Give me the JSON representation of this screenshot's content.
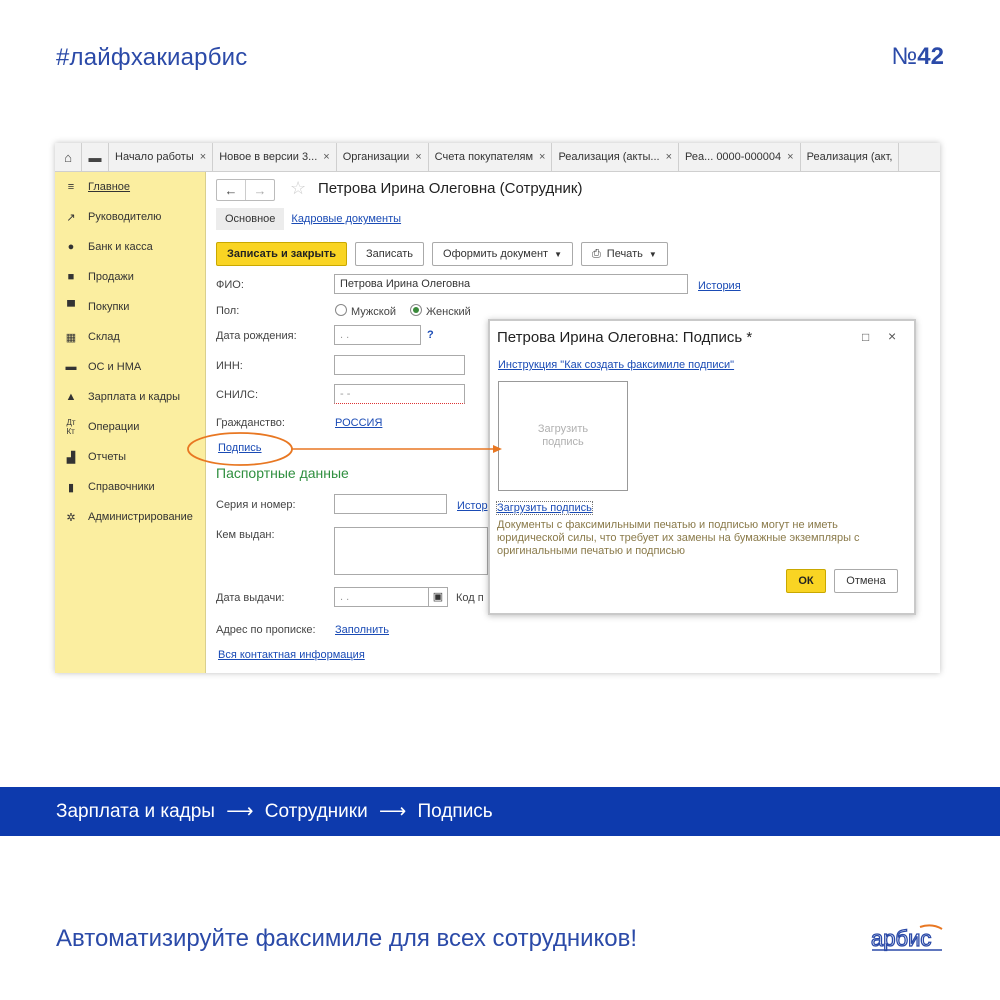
{
  "header": {
    "hashtag": "#лайфхакиарбис",
    "number_prefix": "№",
    "number": "42"
  },
  "tabs": [
    {
      "label": "Начало работы",
      "close": "×"
    },
    {
      "label": "Новое в версии 3...",
      "close": "×"
    },
    {
      "label": "Организации",
      "close": "×"
    },
    {
      "label": "Счета покупателям",
      "close": "×"
    },
    {
      "label": "Реализация (акты...",
      "close": "×"
    },
    {
      "label": "Реа...   0000-000004",
      "close": "×"
    },
    {
      "label": "Реализация (акт,",
      "close": ""
    }
  ],
  "sidebar": {
    "items": [
      {
        "label": "Главное",
        "icon": "menu-icon"
      },
      {
        "label": "Руководителю",
        "icon": "trend-icon"
      },
      {
        "label": "Банк и касса",
        "icon": "coin-icon"
      },
      {
        "label": "Продажи",
        "icon": "bag-icon"
      },
      {
        "label": "Покупки",
        "icon": "cart-icon"
      },
      {
        "label": "Склад",
        "icon": "warehouse-icon"
      },
      {
        "label": "ОС и НМА",
        "icon": "truck-icon"
      },
      {
        "label": "Зарплата и кадры",
        "icon": "person-icon"
      },
      {
        "label": "Операции",
        "icon": "operations-icon"
      },
      {
        "label": "Отчеты",
        "icon": "bar-chart-icon"
      },
      {
        "label": "Справочники",
        "icon": "book-icon"
      },
      {
        "label": "Администрирование",
        "icon": "gear-icon"
      }
    ]
  },
  "form": {
    "title": "Петрова Ирина Олеговна (Сотрудник)",
    "subtab_main": "Основное",
    "subtab_hr": "Кадровые документы",
    "btn_save_close": "Записать и закрыть",
    "btn_save": "Записать",
    "btn_make_doc": "Оформить документ",
    "btn_print": "Печать",
    "fio_label": "ФИО:",
    "fio_value": "Петрова Ирина Олеговна",
    "history": "История",
    "gender_label": "Пол:",
    "gender_male": "Мужской",
    "gender_female": "Женский",
    "birth_label": "Дата рождения:",
    "birth_value": ". .",
    "help": "?",
    "inn_label": "ИНН:",
    "snils_label": "СНИЛС:",
    "snils_value": "-   -",
    "citizenship_label": "Гражданство:",
    "citizenship_value": "РОССИЯ",
    "signature_link": "Подпись",
    "passport_header": "Паспортные данные",
    "series_label": "Серия и номер:",
    "series_history": "Истор",
    "issued_by_label": "Кем выдан:",
    "issue_date_label": "Дата выдачи:",
    "issue_date_value": ". .",
    "code_label": "Код п",
    "address_label": "Адрес по прописке:",
    "address_fill": "Заполнить",
    "all_contacts": "Вся контактная информация"
  },
  "dialog": {
    "title": "Петрова Ирина Олеговна: Подпись *",
    "maximize": "□",
    "close": "×",
    "instruction": "Инструкция \"Как создать факсимиле подписи\"",
    "placeholder": "Загрузить подпись",
    "upload_link": "Загрузить подпись",
    "note": "Документы с факсимильными печатью и подписью могут не иметь юридической силы, что требует их замены на бумажные экземпляры с оригинальными печатью и подписью",
    "ok": "ОК",
    "cancel": "Отмена"
  },
  "breadcrumb": {
    "items": [
      "Зарплата и кадры",
      "Сотрудники",
      "Подпись"
    ],
    "separator": "⟶"
  },
  "tagline": "Автоматизируйте факсимиле для всех сотрудников!",
  "logo_text": "арбис",
  "colors": {
    "brand_blue": "#0d3aad",
    "accent_yellow": "#f9d423",
    "sidebar_bg": "#fbeea0",
    "highlight_orange": "#e87722"
  }
}
